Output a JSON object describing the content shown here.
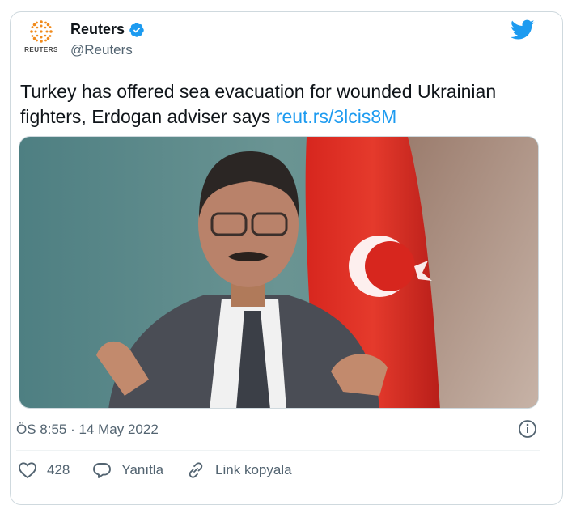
{
  "account": {
    "display_name": "Reuters",
    "handle": "@Reuters",
    "logo_wordmark": "REUTERS",
    "verified": true
  },
  "tweet": {
    "text": "Turkey has offered sea evacuation for wounded Ukrainian fighters, Erdogan adviser says",
    "link": "reut.rs/3lcis8M"
  },
  "meta": {
    "timestamp": "ÖS 8:55 · 14 May 2022"
  },
  "actions": {
    "like_count": "428",
    "reply_label": "Yanıtla",
    "copy_link_label": "Link kopyala"
  },
  "colors": {
    "accent": "#1d9bf0",
    "text": "#0f1419",
    "secondary": "#536471",
    "border": "#cfd9de",
    "reuters_orange": "#f08a1c"
  },
  "icons": [
    "reuters-logo",
    "verified-badge-icon",
    "twitter-bird-icon",
    "info-icon",
    "heart-icon",
    "reply-icon",
    "link-icon"
  ]
}
